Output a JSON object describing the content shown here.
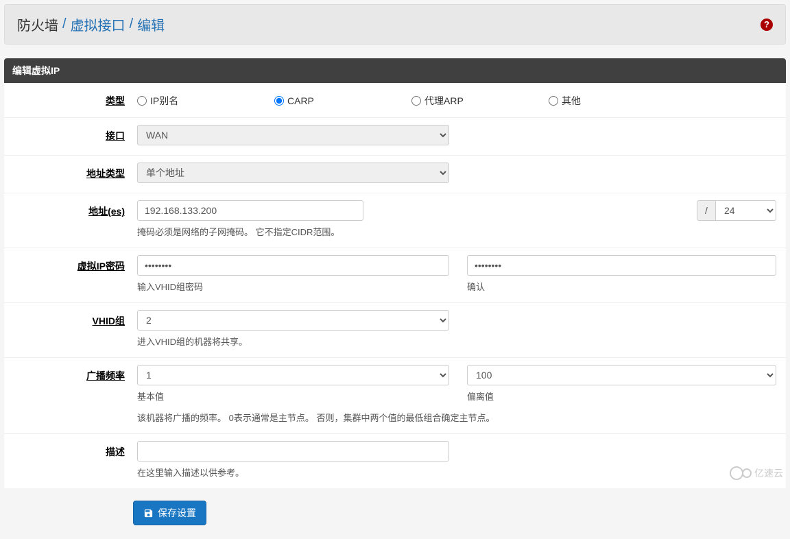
{
  "breadcrumb": {
    "root": "防火墙",
    "link1": "虚拟接口",
    "current": "编辑"
  },
  "panel": {
    "title": "编辑虚拟IP"
  },
  "labels": {
    "type": "类型",
    "interface": "接口",
    "addrType": "地址类型",
    "addresses": "地址(es)",
    "vipPassword": "虚拟IP密码",
    "vhidGroup": "VHID组",
    "advFreq": "广播频率",
    "description": "描述"
  },
  "type": {
    "options": {
      "ipalias": "IP别名",
      "carp": "CARP",
      "proxyarp": "代理ARP",
      "other": "其他"
    },
    "selected": "carp"
  },
  "interface": {
    "selected": "WAN"
  },
  "addrType": {
    "selected": "单个地址"
  },
  "address": {
    "ip": "192.168.133.200",
    "slash": "/",
    "cidr": "24",
    "helper": "掩码必须是网络的子网掩码。 它不指定CIDR范围。"
  },
  "password": {
    "value": "••••••••",
    "confirm_value": "••••••••",
    "helper1": "输入VHID组密码",
    "helper2": "确认"
  },
  "vhid": {
    "selected": "2",
    "helper": "进入VHID组的机器将共享。"
  },
  "advFreq": {
    "base": "1",
    "skew": "100",
    "baseLabel": "基本值",
    "skewLabel": "偏离值",
    "helper": "该机器将广播的频率。 0表示通常是主节点。 否则，集群中两个值的最低组合确定主节点。"
  },
  "description": {
    "value": "",
    "helper": "在这里输入描述以供参考。"
  },
  "buttons": {
    "save": "保存设置"
  },
  "watermark": "亿速云"
}
